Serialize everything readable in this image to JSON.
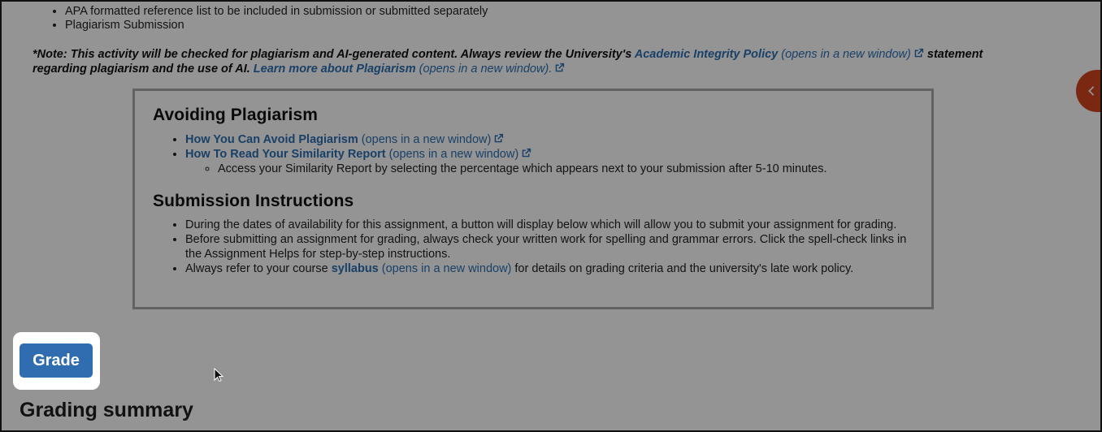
{
  "requirements": {
    "items": [
      "APA formatted reference list to be included in submission or submitted separately",
      "Plagiarism Submission"
    ]
  },
  "note": {
    "prefix": "*Note: This activity will be checked for plagiarism and AI-generated content. Always review the University's ",
    "policy_link": "Academic Integrity Policy",
    "policy_hint": "(opens in a new window)",
    "middle": " statement regarding plagiarism and the use of AI. ",
    "learn_link": "Learn more about Plagiarism",
    "learn_hint": "(opens in a new window)."
  },
  "avoiding": {
    "heading": "Avoiding Plagiarism",
    "link1": "How You Can Avoid Plagiarism",
    "link1_hint": "(opens in a new window)",
    "link2": "How To Read Your Similarity Report",
    "link2_hint": "(opens in a new window)",
    "sub_item": "Access your Similarity Report by selecting the percentage which appears next to your submission after 5-10 minutes."
  },
  "submission": {
    "heading": "Submission Instructions",
    "item1": "During the dates of availability for this assignment, a button will display below which will allow you to submit your assignment for grading.",
    "item2": "Before submitting an assignment for grading, always check your written work for spelling and grammar errors. Click the spell-check links in the Assignment Helps for step-by-step instructions.",
    "item3_prefix": "Always refer to your course ",
    "item3_link": "syllabus",
    "item3_hint": "(opens in a new window)",
    "item3_suffix": " for details on grading criteria and the university's late work policy."
  },
  "grade_button": {
    "label": "Grade"
  },
  "grading_summary": {
    "title": "Grading summary"
  },
  "colors": {
    "link": "#2c6fb2",
    "grade_button": "#2f6db0",
    "side_tab": "#d2451e",
    "overlay": "rgba(0,0,0,0.42)"
  },
  "icons": {
    "external_link": "external-link-icon",
    "side_tab": "chevron-left-icon",
    "cursor": "mouse-pointer-icon"
  }
}
